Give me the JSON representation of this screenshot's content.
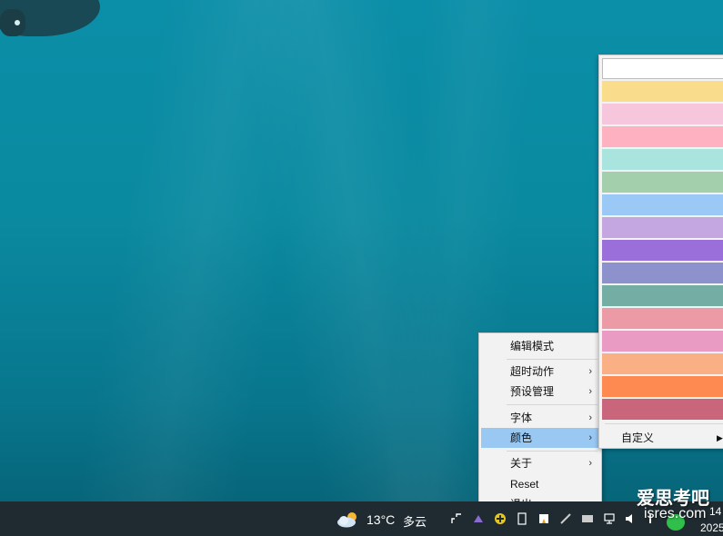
{
  "context_menu": {
    "items": [
      {
        "label": "编辑模式",
        "submenu": false
      },
      {
        "label": "超时动作",
        "submenu": true
      },
      {
        "label": "预设管理",
        "submenu": true
      },
      {
        "label": "字体",
        "submenu": true
      },
      {
        "label": "颜色",
        "submenu": true,
        "active": true
      },
      {
        "label": "关于",
        "submenu": true
      },
      {
        "label": "Reset",
        "submenu": false
      },
      {
        "label": "退出",
        "submenu": false
      }
    ],
    "arrow": "›"
  },
  "color_menu": {
    "swatches": [
      "#ffffff",
      "#f9dc8c",
      "#f5c6dc",
      "#fdb1c1",
      "#a9e4de",
      "#a3cfad",
      "#9ac9f6",
      "#c4a6e0",
      "#9b6fd9",
      "#8d91cc",
      "#73ada3",
      "#eb9aa6",
      "#e99bc4",
      "#fbaf85",
      "#fe8951",
      "#c9667c"
    ],
    "custom_label": "自定义",
    "custom_arrow": "▶"
  },
  "taskbar": {
    "temperature": "13°C",
    "condition": "多云",
    "clock_time": "14",
    "clock_date": "2025"
  },
  "watermark": {
    "line1": "爱思考吧",
    "line2": "isres.com"
  }
}
